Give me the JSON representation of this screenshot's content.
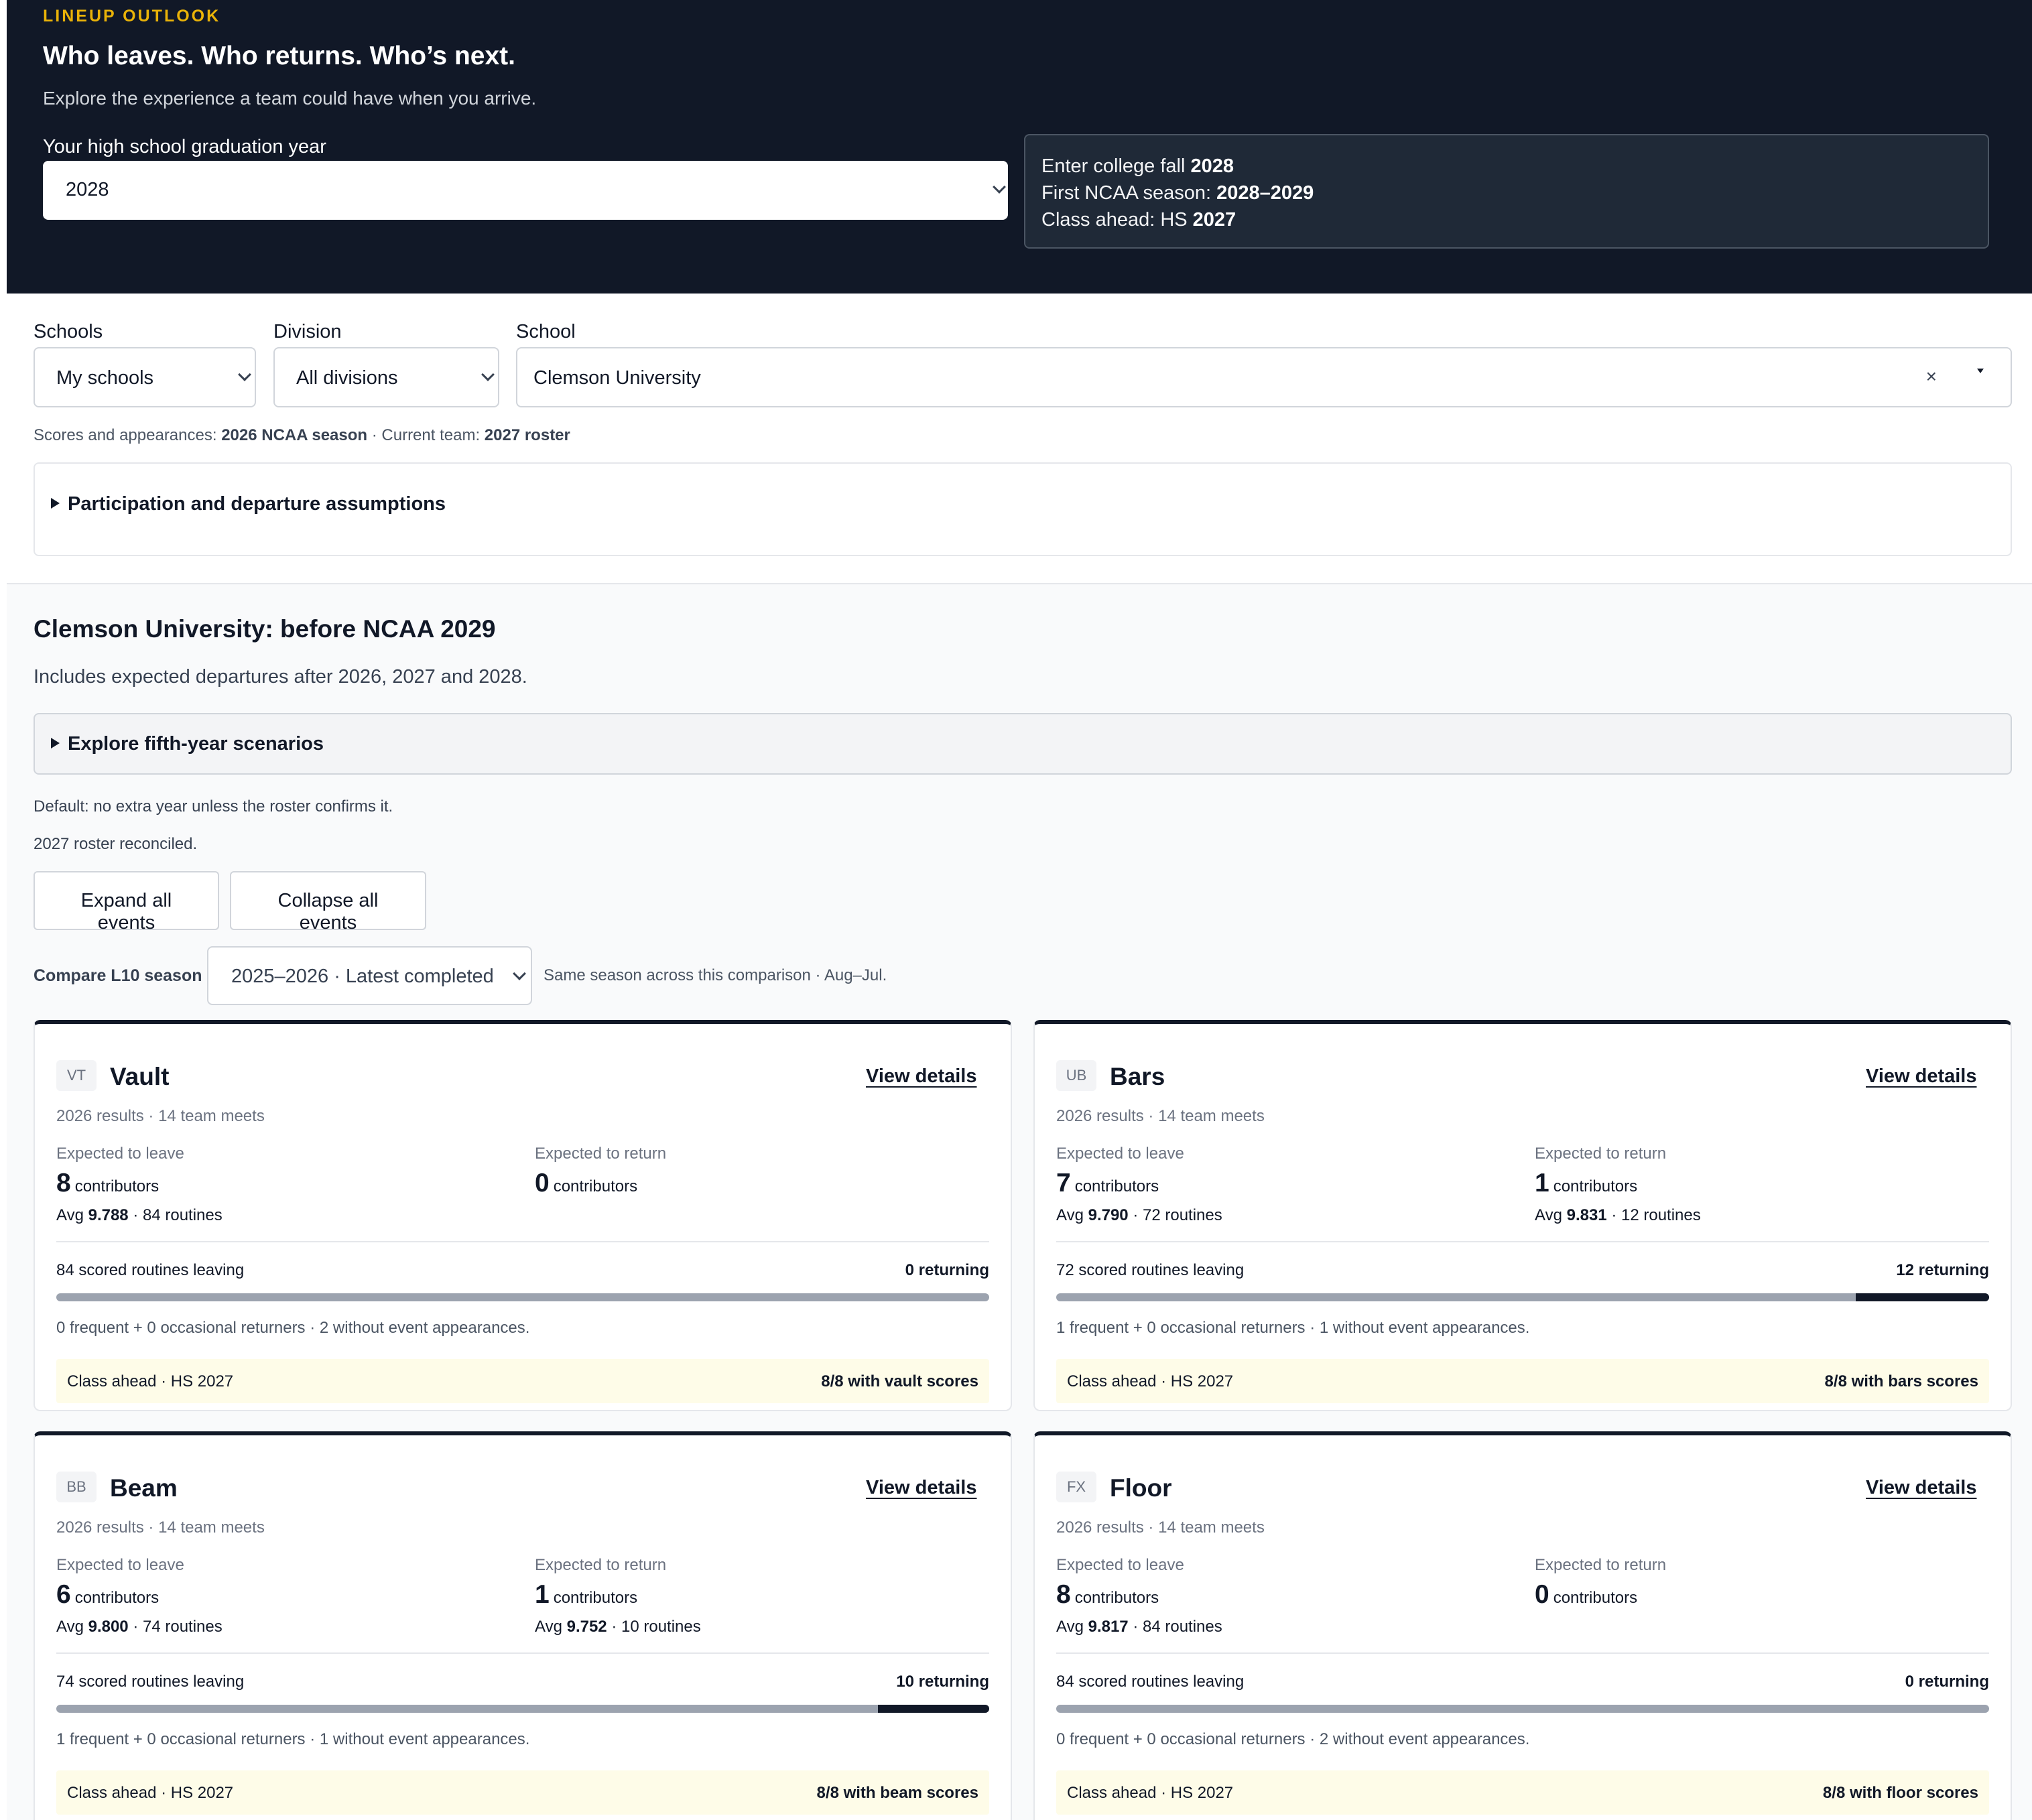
{
  "hero": {
    "eyebrow": "LINEUP OUTLOOK",
    "title": "Who leaves. Who returns. Who’s next.",
    "subtitle": "Explore the experience a team could have when you arrive.",
    "grad_label": "Your high school graduation year",
    "grad_value": "2028",
    "info": {
      "enter_prefix": "Enter college fall ",
      "enter_value": "2028",
      "season_prefix": "First NCAA season: ",
      "season_value": "2028–2029",
      "class_prefix": "Class ahead: HS ",
      "class_value": "2027"
    }
  },
  "filters": {
    "schools_label": "Schools",
    "schools_value": "My schools",
    "division_label": "Division",
    "division_value": "All divisions",
    "school_label": "School",
    "school_value": "Clemson University",
    "clear_glyph": "×"
  },
  "meta": {
    "scores_prefix": "Scores and appearances: ",
    "scores_value": "2026 NCAA season",
    "team_prefix": " · Current team: ",
    "team_value": "2027 roster"
  },
  "assumptions_label": "Participation and departure assumptions",
  "section": {
    "title": "Clemson University: before NCAA 2029",
    "subtitle": "Includes expected departures after 2026, 2027 and 2028.",
    "fifth_year_label": "Explore fifth-year scenarios",
    "default_note": "Default: no extra year unless the roster confirms it.",
    "roster_note": "2027 roster reconciled.",
    "expand_label": "Expand all events",
    "collapse_label": "Collapse all events",
    "compare_label": "Compare L10 season",
    "compare_value": "2025–2026 · Latest completed",
    "compare_note": "Same season across this comparison · Aug–Jul."
  },
  "events": [
    {
      "code": "VT",
      "name": "Vault",
      "details_label": "View details",
      "results": "2026 results · 14 team meets",
      "leave_header": "Expected to leave",
      "leave_count": "8",
      "leave_unit": "contributors",
      "leave_avg_prefix": "Avg ",
      "leave_avg": "9.788",
      "leave_routines": " · 84 routines",
      "return_header": "Expected to return",
      "return_count": "0",
      "return_unit": "contributors",
      "return_avg_prefix": "",
      "return_avg": "",
      "return_routines": "",
      "leaving_label": "84 scored routines leaving",
      "returning_label": "0 returning",
      "returning_fraction": 0,
      "freq_note": "0 frequent + 0 occasional returners · 2 without event appearances.",
      "ahead_label": "Class ahead · HS 2027",
      "ahead_scores": "8/8 with vault scores"
    },
    {
      "code": "UB",
      "name": "Bars",
      "details_label": "View details",
      "results": "2026 results · 14 team meets",
      "leave_header": "Expected to leave",
      "leave_count": "7",
      "leave_unit": "contributors",
      "leave_avg_prefix": "Avg ",
      "leave_avg": "9.790",
      "leave_routines": " · 72 routines",
      "return_header": "Expected to return",
      "return_count": "1",
      "return_unit": "contributors",
      "return_avg_prefix": "Avg ",
      "return_avg": "9.831",
      "return_routines": " · 12 routines",
      "leaving_label": "72 scored routines leaving",
      "returning_label": "12 returning",
      "returning_fraction": 0.143,
      "freq_note": "1 frequent + 0 occasional returners · 1 without event appearances.",
      "ahead_label": "Class ahead · HS 2027",
      "ahead_scores": "8/8 with bars scores"
    },
    {
      "code": "BB",
      "name": "Beam",
      "details_label": "View details",
      "results": "2026 results · 14 team meets",
      "leave_header": "Expected to leave",
      "leave_count": "6",
      "leave_unit": "contributors",
      "leave_avg_prefix": "Avg ",
      "leave_avg": "9.800",
      "leave_routines": " · 74 routines",
      "return_header": "Expected to return",
      "return_count": "1",
      "return_unit": "contributors",
      "return_avg_prefix": "Avg ",
      "return_avg": "9.752",
      "return_routines": " · 10 routines",
      "leaving_label": "74 scored routines leaving",
      "returning_label": "10 returning",
      "returning_fraction": 0.119,
      "freq_note": "1 frequent + 0 occasional returners · 1 without event appearances.",
      "ahead_label": "Class ahead · HS 2027",
      "ahead_scores": "8/8 with beam scores"
    },
    {
      "code": "FX",
      "name": "Floor",
      "details_label": "View details",
      "results": "2026 results · 14 team meets",
      "leave_header": "Expected to leave",
      "leave_count": "8",
      "leave_unit": "contributors",
      "leave_avg_prefix": "Avg ",
      "leave_avg": "9.817",
      "leave_routines": " · 84 routines",
      "return_header": "Expected to return",
      "return_count": "0",
      "return_unit": "contributors",
      "return_avg_prefix": "",
      "return_avg": "",
      "return_routines": "",
      "leaving_label": "84 scored routines leaving",
      "returning_label": "0 returning",
      "returning_fraction": 0,
      "freq_note": "0 frequent + 0 occasional returners · 2 without event appearances.",
      "ahead_label": "Class ahead · HS 2027",
      "ahead_scores": "8/8 with floor scores"
    }
  ]
}
